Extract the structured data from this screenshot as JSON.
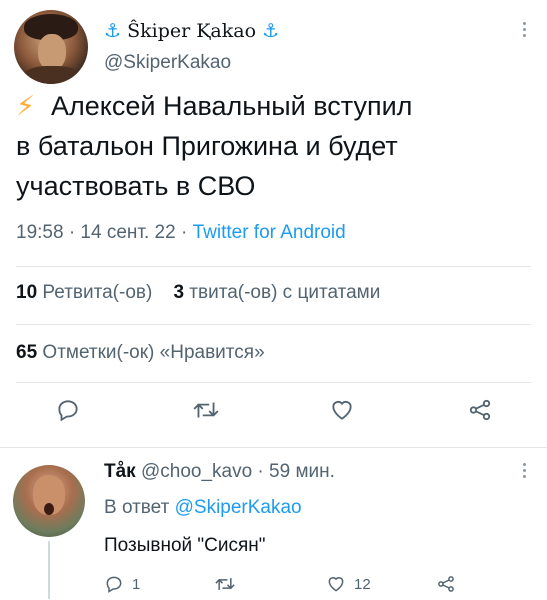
{
  "tweet": {
    "display_name": "Ŝkiper Ⱪakao",
    "anchor_left": "⚓",
    "anchor_right": "⚓",
    "handle": "@SkiperKakao",
    "bolt": "⚡",
    "text_line1": "Алексей Навальный вступил",
    "text_line2": "в батальон Пригожина и будет",
    "text_line3": "участвовать в СВО",
    "time_date": "19:58 · 14 сент. 22 · ",
    "source": "Twitter for Android",
    "retweets_count": "10",
    "retweets_label": " Ретвита(-ов)",
    "quotes_count": "3",
    "quotes_label": " твита(-ов) с цитатами",
    "likes_count": "65",
    "likes_label": " Отметки(-ок) «Нравится»"
  },
  "reply": {
    "name": "Tåк",
    "handle_time": " @choo_kavo · 59 мин.",
    "replying_prefix": "В ответ ",
    "replying_mention": "@SkiperKakao",
    "text": "Позывной \"Сисян\"",
    "reply_count": "1",
    "like_count": "12"
  },
  "icons": [
    "reply-icon",
    "retweet-icon",
    "like-icon",
    "share-icon",
    "more-icon"
  ],
  "colors": {
    "accent": "#1d9bf0",
    "secondary_text": "#536471",
    "primary_text": "#0f1419",
    "bolt": "#ffac33"
  }
}
